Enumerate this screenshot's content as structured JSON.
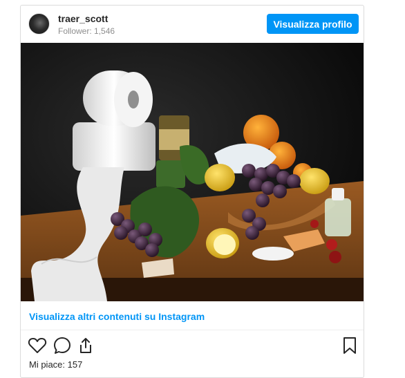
{
  "post": {
    "username": "traer_scott",
    "followers": "Follower: 1,546",
    "view_profile_button": "Visualizza profilo",
    "more_link": "Visualizza altri contenuti su Instagram",
    "likes": "Mi piace: 157"
  },
  "icons": {
    "like": "heart-icon",
    "comment": "comment-icon",
    "share": "share-icon",
    "save": "bookmark-icon"
  },
  "colors": {
    "accent": "#0095f6",
    "text": "#262626",
    "muted": "#8e8e8e",
    "border": "#dbdbdb"
  }
}
